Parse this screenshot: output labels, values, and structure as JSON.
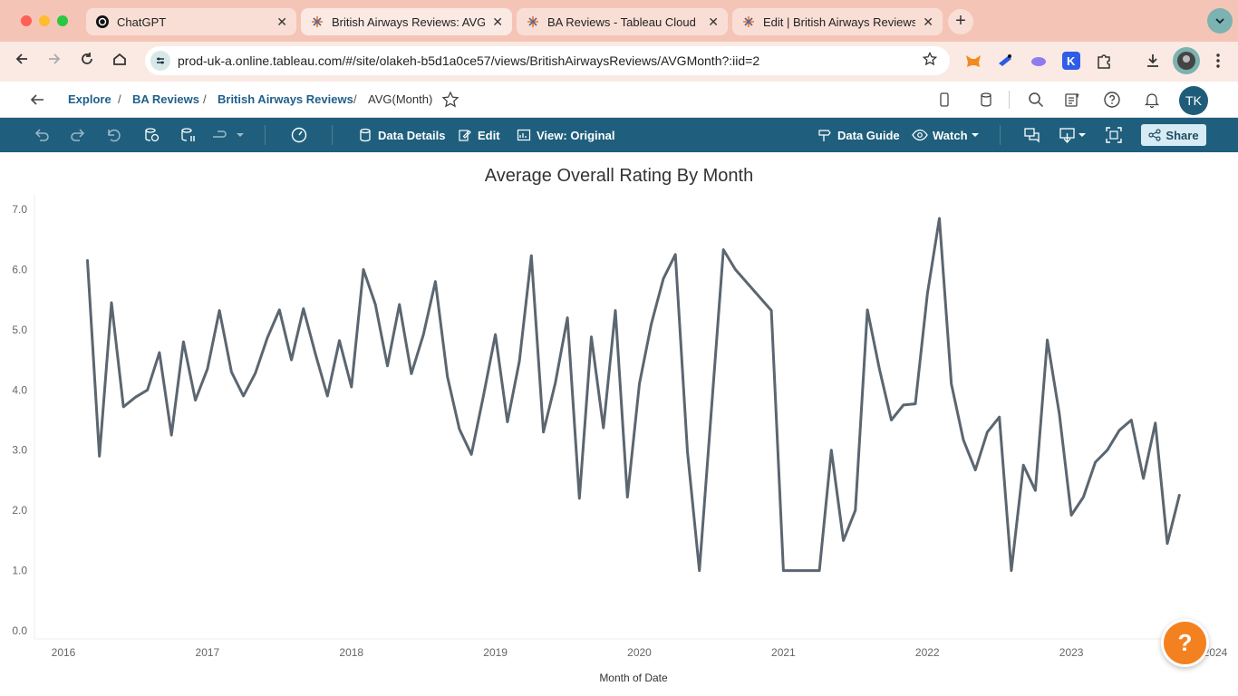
{
  "browser": {
    "tabs": [
      {
        "title": "ChatGPT",
        "icon": "chatgpt-icon",
        "active": false
      },
      {
        "title": "British Airways Reviews: AVG",
        "icon": "tableau-icon",
        "active": true
      },
      {
        "title": "BA Reviews - Tableau Cloud",
        "icon": "tableau-icon",
        "active": false
      },
      {
        "title": "Edit | British Airways Reviews",
        "icon": "tableau-icon",
        "active": false
      }
    ],
    "close_glyph": "✕",
    "new_tab_glyph": "+",
    "url": "prod-uk-a.online.tableau.com/#/site/olakeh-b5d1a0ce57/views/BritishAirwaysReviews/AVGMonth?:iid=2"
  },
  "breadcrumb": {
    "items": [
      "Explore",
      "BA Reviews",
      "British Airways Reviews"
    ],
    "separator": "/",
    "current": "AVG(Month)"
  },
  "user": {
    "initials": "TK"
  },
  "toolbar": {
    "data_details": "Data Details",
    "edit": "Edit",
    "view": "View: Original",
    "data_guide": "Data Guide",
    "watch": "Watch",
    "share": "Share"
  },
  "help": {
    "glyph": "?"
  },
  "colors": {
    "line": "#5b6670",
    "toolbar": "#1f5f7d",
    "help": "#f4811f"
  },
  "chart_data": {
    "type": "line",
    "title": "Average Overall Rating By Month",
    "xlabel": "Month of Date",
    "ylabel": "",
    "ylim": [
      0,
      7
    ],
    "yticks": [
      "0.0",
      "1.0",
      "2.0",
      "3.0",
      "4.0",
      "5.0",
      "6.0",
      "7.0"
    ],
    "xticks": [
      "2016",
      "2017",
      "2018",
      "2019",
      "2020",
      "2021",
      "2022",
      "2023",
      "2024"
    ],
    "xlim": [
      "2016-01",
      "2024-01"
    ],
    "grid": false,
    "series": [
      {
        "x": [
          "2016-03",
          "2016-04",
          "2016-05",
          "2016-06",
          "2016-07",
          "2016-08",
          "2016-09",
          "2016-10",
          "2016-11",
          "2016-12",
          "2017-01",
          "2017-02",
          "2017-03",
          "2017-04",
          "2017-05",
          "2017-06",
          "2017-07",
          "2017-08",
          "2017-09",
          "2017-10",
          "2017-11",
          "2017-12",
          "2018-01",
          "2018-02",
          "2018-03",
          "2018-04",
          "2018-05",
          "2018-06",
          "2018-07",
          "2018-08",
          "2018-09",
          "2018-10",
          "2018-11",
          "2018-12",
          "2019-01",
          "2019-02",
          "2019-03",
          "2019-04",
          "2019-05",
          "2019-06",
          "2019-07",
          "2019-08",
          "2019-09",
          "2019-10",
          "2019-11",
          "2019-12",
          "2020-01",
          "2020-02",
          "2020-03",
          "2020-04",
          "2020-05",
          "2020-06",
          "2020-08",
          "2020-09",
          "2020-12",
          "2021-01",
          "2021-04",
          "2021-05",
          "2021-06",
          "2021-07",
          "2021-08",
          "2021-09",
          "2021-10",
          "2021-11",
          "2021-12",
          "2022-01",
          "2022-02",
          "2022-03",
          "2022-04",
          "2022-05",
          "2022-06",
          "2022-07",
          "2022-08",
          "2022-09",
          "2022-10",
          "2022-11",
          "2022-12",
          "2023-01",
          "2023-02",
          "2023-03",
          "2023-04",
          "2023-05",
          "2023-06",
          "2023-07",
          "2023-08",
          "2023-09",
          "2023-10"
        ],
        "values": [
          6.15,
          2.9,
          5.45,
          3.72,
          3.88,
          4.0,
          4.62,
          3.25,
          4.8,
          3.83,
          4.35,
          5.32,
          4.3,
          3.9,
          4.28,
          4.87,
          5.33,
          4.5,
          5.35,
          4.6,
          3.9,
          4.82,
          4.05,
          6.0,
          5.42,
          4.4,
          5.42,
          4.27,
          4.92,
          5.8,
          4.22,
          3.35,
          2.93,
          3.9,
          4.92,
          3.47,
          4.48,
          6.23,
          3.3,
          4.12,
          5.2,
          2.2,
          4.88,
          3.37,
          5.32,
          2.22,
          4.1,
          5.1,
          5.85,
          6.25,
          2.98,
          1.0,
          6.33,
          6.0,
          5.32,
          1.0,
          1.0,
          3.0,
          1.5,
          2.0,
          5.33,
          4.35,
          3.5,
          3.75,
          3.77,
          5.6,
          6.85,
          4.1,
          3.17,
          2.67,
          3.3,
          3.55,
          1.0,
          2.75,
          2.33,
          4.83,
          3.6,
          1.92,
          2.22,
          2.8,
          3.0,
          3.33,
          3.5,
          2.53,
          3.45,
          1.45,
          2.25
        ]
      }
    ]
  }
}
